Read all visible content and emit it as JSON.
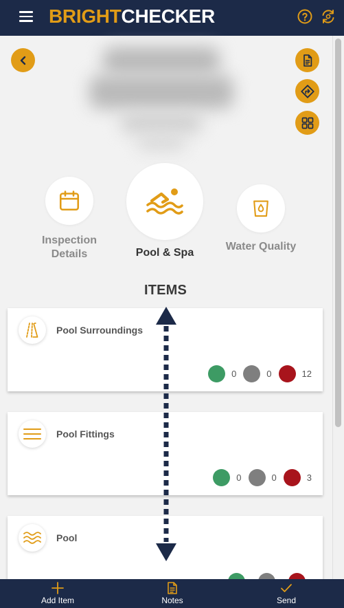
{
  "header": {
    "logo_part1": "BRIGHT",
    "logo_part2": "CHECKER",
    "icons": [
      "menu-icon",
      "help-icon",
      "sync-icon"
    ]
  },
  "side_actions": [
    "document-icon",
    "directions-icon",
    "grid-icon"
  ],
  "categories": [
    {
      "label_line1": "Inspection",
      "label_line2": "Details",
      "icon": "calendar-icon",
      "active": false
    },
    {
      "label": "Pool & Spa",
      "icon": "swimmer-icon",
      "active": true
    },
    {
      "label": "Water Quality",
      "icon": "water-glass-icon",
      "active": false
    }
  ],
  "items_heading": "ITEMS",
  "items": [
    {
      "title": "Pool Surroundings",
      "icon": "surroundings-icon",
      "green": "0",
      "grey": "0",
      "red": "12"
    },
    {
      "title": "Pool Fittings",
      "icon": "lines-icon",
      "green": "0",
      "grey": "0",
      "red": "3"
    },
    {
      "title": "Pool",
      "icon": "waves-icon",
      "green": "",
      "grey": "",
      "red": ""
    }
  ],
  "status_colors": {
    "green": "#3d9b64",
    "grey": "#7f7f7f",
    "red": "#a8141c"
  },
  "colors": {
    "accent": "#e19c17",
    "navy": "#1c2a48"
  },
  "bottom_nav": {
    "add_label": "Add Item",
    "notes_label": "Notes",
    "send_label": "Send"
  }
}
